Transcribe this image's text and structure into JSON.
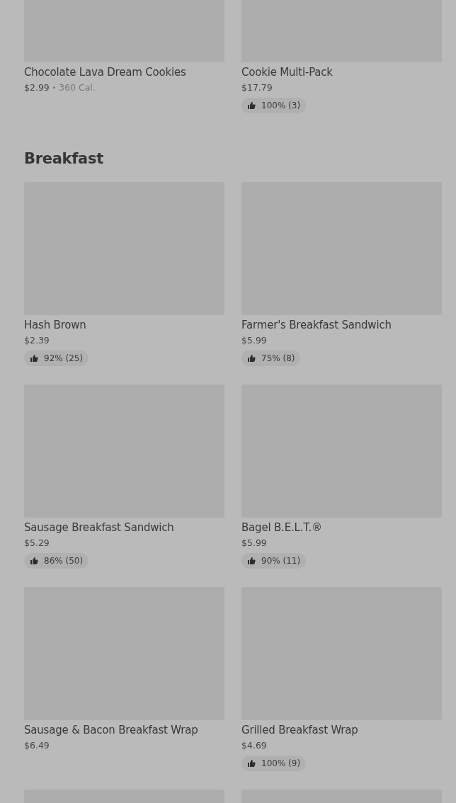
{
  "sections": [
    {
      "items": [
        {
          "kind": "item",
          "name": "Chocolate Lava Dream Cookies",
          "price": "$2.99",
          "separator": "•",
          "calories": "360 Cal."
        },
        {
          "kind": "item",
          "name": "Cookie Multi-Pack",
          "price": "$17.79",
          "rating": "100% (3)"
        }
      ]
    },
    {
      "title": "Breakfast",
      "items": [
        {
          "kind": "item",
          "name": "Hash Brown",
          "price": "$2.39",
          "rating": "92% (25)"
        },
        {
          "kind": "item",
          "name": "Farmer's Breakfast Sandwich",
          "price": "$5.99",
          "rating": "75% (8)"
        },
        {
          "kind": "item",
          "name": "Sausage Breakfast Sandwich",
          "price": "$5.29",
          "rating": "86% (50)"
        },
        {
          "kind": "item",
          "name": "Bagel B.E.L.T.®",
          "price": "$5.99",
          "rating": "90% (11)"
        },
        {
          "kind": "item",
          "name": "Sausage & Bacon Breakfast Wrap",
          "price": "$6.49"
        },
        {
          "kind": "item",
          "name": "Grilled Breakfast Wrap",
          "price": "$4.69",
          "rating": "100% (9)"
        },
        {
          "kind": "picture"
        },
        {
          "kind": "picture"
        }
      ]
    }
  ]
}
